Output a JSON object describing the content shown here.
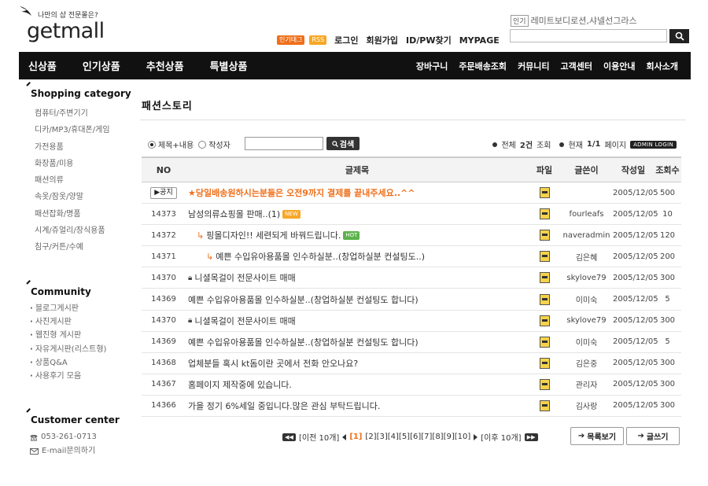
{
  "header": {
    "tagline": "나만의 샵 전문몰은?",
    "logo": "getmall",
    "pills": [
      "인기태그",
      "RSS"
    ],
    "links": [
      "로그인",
      "회원가입",
      "ID/PW찾기",
      "MYPAGE"
    ],
    "popular_label": "인기",
    "popular_terms": "레미트보디로션,샤넬선그라스"
  },
  "nav": {
    "main": [
      "신상품",
      "인기상품",
      "추천상품",
      "특별상품"
    ],
    "sub": [
      "장바구니",
      "주문배송조회",
      "커뮤니티",
      "고객센터",
      "이용안내",
      "회사소개"
    ]
  },
  "sidebar": {
    "shopping_title": "Shopping category",
    "categories": [
      "컴퓨터/주변기기",
      "디카/MP3/휴대폰/게임",
      "가전용품",
      "화장품/미용",
      "패션의류",
      "속옷/잠옷/양말",
      "패션잡화/명품",
      "시계/쥬얼리/장식용품",
      "침구/커튼/수예"
    ],
    "community_title": "Community",
    "community": [
      "블로그게시판",
      "사진게시판",
      "웹진형 게시판",
      "자유게시판(리스트형)",
      "상품Q&A",
      "사용후기 모음"
    ],
    "customer_title": "Customer center",
    "phone": "053-261-0713",
    "email": "E-mail문의하기"
  },
  "board": {
    "title": "패션스토리",
    "search": {
      "opt1": "제목+내용",
      "opt2": "작성자",
      "button": "검색",
      "total": "전체",
      "total_count": "2건",
      "total_suffix": "조회",
      "current": "현재",
      "page_info": "1/1",
      "page_suffix": "페이지",
      "admin": "ADMIN LOGIN"
    },
    "columns": [
      "NO",
      "글제목",
      "파일",
      "글쓴이",
      "작성일",
      "조회수"
    ],
    "notice": {
      "badge": "공지",
      "title": "★당일배송원하시는분들은 오전9까지 결제를 끝내주세요..^^",
      "author": "",
      "date": "2005/12/05",
      "views": "500"
    },
    "rows": [
      {
        "no": "14373",
        "title": "남성의류쇼핑몰 판매..(1)",
        "author": "fourleafs",
        "date": "2005/12/05",
        "views": "10"
      },
      {
        "no": "14372",
        "title": "핑몰디자인!! 세련되게 바꿔드립니다.",
        "author": "naveradmin",
        "date": "2005/12/05",
        "views": "120"
      },
      {
        "no": "14371",
        "title": "예쁜 수입유아용품몰 인수하실분..(창업하실분 컨설팅도..)",
        "author": "김은혜",
        "date": "2005/12/05",
        "views": "200"
      },
      {
        "no": "14370",
        "title": "니셜목걸이 전문사이트 매매",
        "author": "skylove79",
        "date": "2005/12/05",
        "views": "300"
      },
      {
        "no": "14369",
        "title": "예쁜 수입유아용품몰 인수하실분..(창업하실분 컨설팅도 합니다)",
        "author": "이미숙",
        "date": "2005/12/05",
        "views": "5"
      },
      {
        "no": "14370",
        "title": "니셜목걸이 전문사이트 매매",
        "author": "skylove79",
        "date": "2005/12/05",
        "views": "300"
      },
      {
        "no": "14369",
        "title": "예쁜 수입유아용품몰 인수하실분..(창업하실분 컨설팅도 합니다)",
        "author": "이미숙",
        "date": "2005/12/05",
        "views": "5"
      },
      {
        "no": "14368",
        "title": "업체분들 혹시 kt돔이란 곳에서 전화 안오나요?",
        "author": "김은중",
        "date": "2005/12/05",
        "views": "300"
      },
      {
        "no": "14367",
        "title": "홈페이지 제작중에 있습니다.",
        "author": "관리자",
        "date": "2005/12/05",
        "views": "300"
      },
      {
        "no": "14366",
        "title": "가을 정기 6%세일 중입니다.많은 관심 부탁드립니다.",
        "author": "김사랑",
        "date": "2005/12/05",
        "views": "300"
      }
    ],
    "tags": {
      "new": "NEW",
      "hot": "HOT"
    },
    "pager": {
      "prev": "[이전 10개]",
      "current": "[1]",
      "pages": "[2][3][4][5][6][7][8][9][10]",
      "next": "[이후 10개]"
    },
    "list_btn": "목록보기",
    "write_btn": "글쓰기"
  },
  "colors": {
    "accent": "#ef6f1a",
    "nav_bg": "#111111",
    "new": "#f7a727",
    "hot": "#5bb34a"
  }
}
